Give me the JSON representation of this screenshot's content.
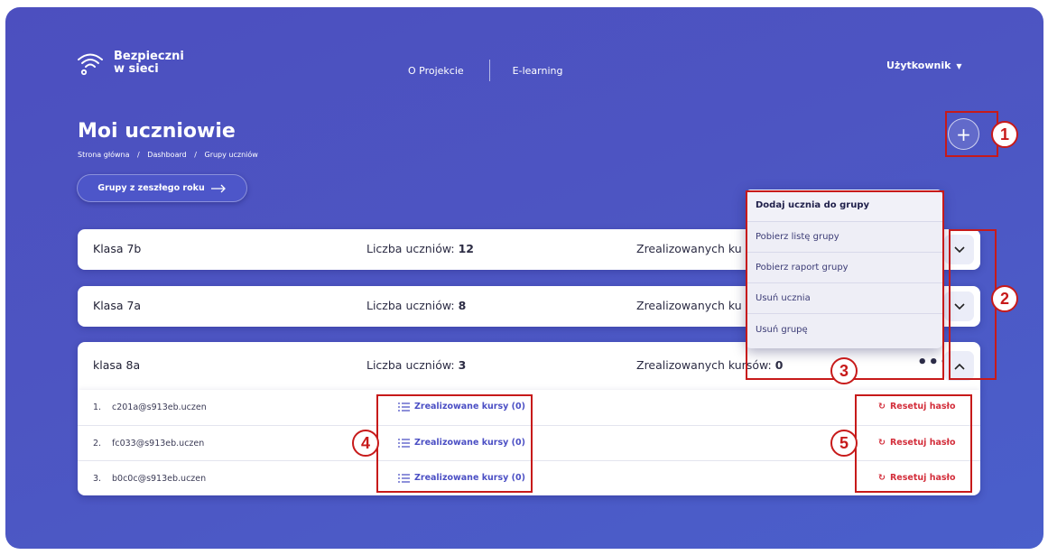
{
  "header": {
    "logo_line1": "Bezpieczni",
    "logo_line2": "w sieci",
    "nav": [
      "O Projekcie",
      "E-learning"
    ],
    "user_menu": "Użytkownik"
  },
  "page": {
    "title": "Moi uczniowie",
    "breadcrumb": [
      "Strona główna",
      "Dashboard",
      "Grupy uczniów"
    ],
    "breadcrumb_sep": "/",
    "prev_year_button": "Grupy z zeszłego roku"
  },
  "groups": [
    {
      "name": "Klasa 7b",
      "count_label": "Liczba uczniów:",
      "count": "12",
      "done_label": "Zrealizowanych ku"
    },
    {
      "name": "Klasa 7a",
      "count_label": "Liczba uczniów:",
      "count": "8",
      "done_label": "Zrealizowanych ku"
    },
    {
      "name": "klasa 8a",
      "count_label": "Liczba uczniów:",
      "count": "3",
      "done_label": "Zrealizowanych kursów:",
      "done": "0"
    }
  ],
  "students": [
    {
      "idx": "1.",
      "email": "c201a@s913eb.uczen",
      "courses": "Zrealizowane kursy (0)",
      "reset": "Resetuj hasło"
    },
    {
      "idx": "2.",
      "email": "fc033@s913eb.uczen",
      "courses": "Zrealizowane kursy (0)",
      "reset": "Resetuj hasło"
    },
    {
      "idx": "3.",
      "email": "b0c0c@s913eb.uczen",
      "courses": "Zrealizowane kursy (0)",
      "reset": "Resetuj hasło"
    }
  ],
  "group_menu": [
    "Dodaj ucznia do grupy",
    "Pobierz listę grupy",
    "Pobierz raport grupy",
    "Usuń ucznia",
    "Usuń grupę"
  ],
  "annotations": [
    "1",
    "2",
    "3",
    "4",
    "5"
  ],
  "icons": {
    "logo": "wifi-logo-icon",
    "user_caret": "caret-down-icon",
    "add": "plus-icon",
    "prev_year_arrow": "arrow-right-icon",
    "expand": "chevron-down-icon",
    "collapse": "chevron-up-icon",
    "more": "more-dots-icon",
    "courses": "list-icon",
    "reset": "refresh-icon"
  },
  "colors": {
    "background": "#4d55c2",
    "accent": "#4b4fc4",
    "danger": "#d32e3b",
    "annotation": "#c71a1a"
  }
}
